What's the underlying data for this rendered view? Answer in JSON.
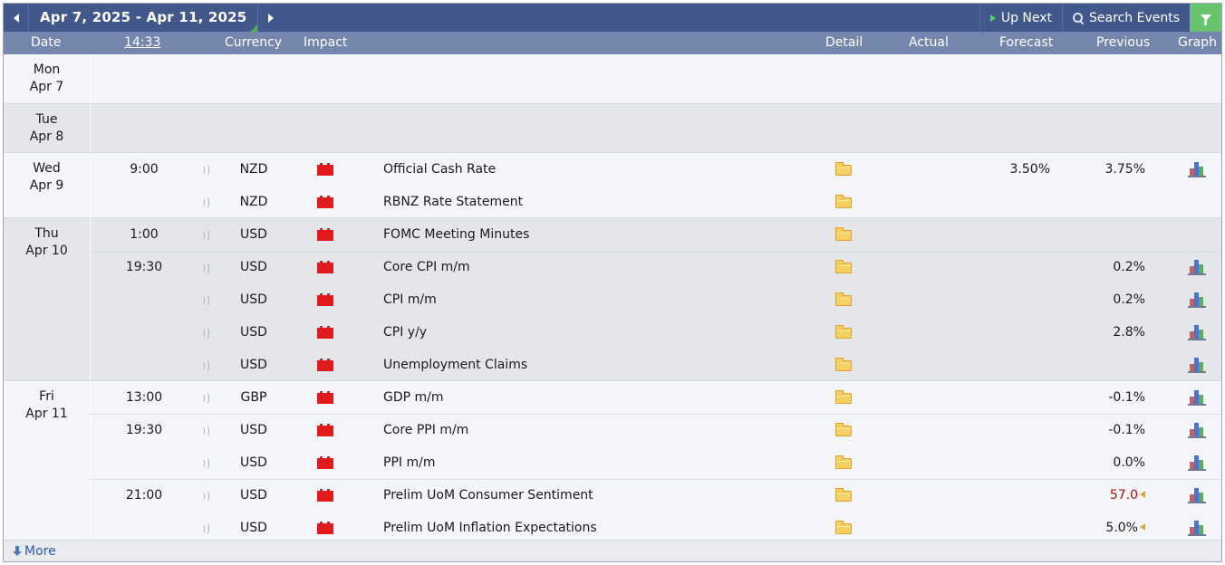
{
  "toolbar": {
    "date_range": "Apr 7, 2025 - Apr 11, 2025",
    "up_next_label": "Up Next",
    "search_label": "Search Events"
  },
  "columns": {
    "date": "Date",
    "time": "14:33",
    "currency": "Currency",
    "impact": "Impact",
    "detail": "Detail",
    "actual": "Actual",
    "forecast": "Forecast",
    "previous": "Previous",
    "graph": "Graph"
  },
  "colors": {
    "header_bar": "#42578a",
    "column_bar": "#7586ac",
    "high_impact": "#e11b1b",
    "filter_accent": "#67c36c",
    "revised_red": "#b01010",
    "revised_arrow": "#f0a02a"
  },
  "days": [
    {
      "weekday": "Mon",
      "date": "Apr 7",
      "shade": "light",
      "events": []
    },
    {
      "weekday": "Tue",
      "date": "Apr 8",
      "shade": "dark",
      "events": []
    },
    {
      "weekday": "Wed",
      "date": "Apr 9",
      "shade": "light",
      "events": [
        {
          "time": "9:00",
          "currency": "NZD",
          "impact": "high",
          "name": "Official Cash Rate",
          "actual": "",
          "forecast": "3.50%",
          "previous": "3.75%",
          "graph": true,
          "group_start": true
        },
        {
          "time": "",
          "currency": "NZD",
          "impact": "high",
          "name": "RBNZ Rate Statement",
          "actual": "",
          "forecast": "",
          "previous": "",
          "graph": false,
          "group_start": false
        }
      ]
    },
    {
      "weekday": "Thu",
      "date": "Apr 10",
      "shade": "dark",
      "events": [
        {
          "time": "1:00",
          "currency": "USD",
          "impact": "high",
          "name": "FOMC Meeting Minutes",
          "actual": "",
          "forecast": "",
          "previous": "",
          "graph": false,
          "group_start": true
        },
        {
          "time": "19:30",
          "currency": "USD",
          "impact": "high",
          "name": "Core CPI m/m",
          "actual": "",
          "forecast": "",
          "previous": "0.2%",
          "graph": true,
          "group_start": true
        },
        {
          "time": "",
          "currency": "USD",
          "impact": "high",
          "name": "CPI m/m",
          "actual": "",
          "forecast": "",
          "previous": "0.2%",
          "graph": true,
          "group_start": false
        },
        {
          "time": "",
          "currency": "USD",
          "impact": "high",
          "name": "CPI y/y",
          "actual": "",
          "forecast": "",
          "previous": "2.8%",
          "graph": true,
          "group_start": false
        },
        {
          "time": "",
          "currency": "USD",
          "impact": "high",
          "name": "Unemployment Claims",
          "actual": "",
          "forecast": "",
          "previous": "",
          "graph": true,
          "group_start": false
        }
      ]
    },
    {
      "weekday": "Fri",
      "date": "Apr 11",
      "shade": "light",
      "events": [
        {
          "time": "13:00",
          "currency": "GBP",
          "impact": "high",
          "name": "GDP m/m",
          "actual": "",
          "forecast": "",
          "previous": "-0.1%",
          "graph": true,
          "group_start": true
        },
        {
          "time": "19:30",
          "currency": "USD",
          "impact": "high",
          "name": "Core PPI m/m",
          "actual": "",
          "forecast": "",
          "previous": "-0.1%",
          "graph": true,
          "group_start": true
        },
        {
          "time": "",
          "currency": "USD",
          "impact": "high",
          "name": "PPI m/m",
          "actual": "",
          "forecast": "",
          "previous": "0.0%",
          "graph": true,
          "group_start": false
        },
        {
          "time": "21:00",
          "currency": "USD",
          "impact": "high",
          "name": "Prelim UoM Consumer Sentiment",
          "actual": "",
          "forecast": "",
          "previous": "57.0",
          "previous_revised": "worse",
          "graph": true,
          "group_start": true
        },
        {
          "time": "",
          "currency": "USD",
          "impact": "high",
          "name": "Prelim UoM Inflation Expectations",
          "actual": "",
          "forecast": "",
          "previous": "5.0%",
          "previous_revised": "better",
          "graph": true,
          "group_start": false
        }
      ]
    }
  ],
  "footer": {
    "more_label": "More"
  }
}
